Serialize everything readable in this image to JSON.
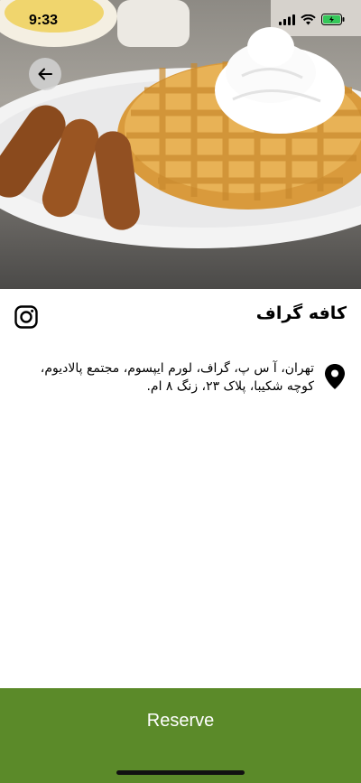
{
  "status_bar": {
    "time": "9:33"
  },
  "hero": {
    "image_subject": "waffle with whipped cream and sausages"
  },
  "header": {
    "back_icon": "arrow-left-icon"
  },
  "cafe": {
    "name": "کافه گراف",
    "address": "تهران، آ س پ، گراف، لورم ایپسوم، مجتمع پالادیوم، کوچه شکیبا، پلاک ۲۳، زنگ ۸ ام."
  },
  "footer": {
    "reserve_label": "Reserve"
  },
  "colors": {
    "accent_green": "#5b8a29",
    "battery_green": "#34c759"
  }
}
